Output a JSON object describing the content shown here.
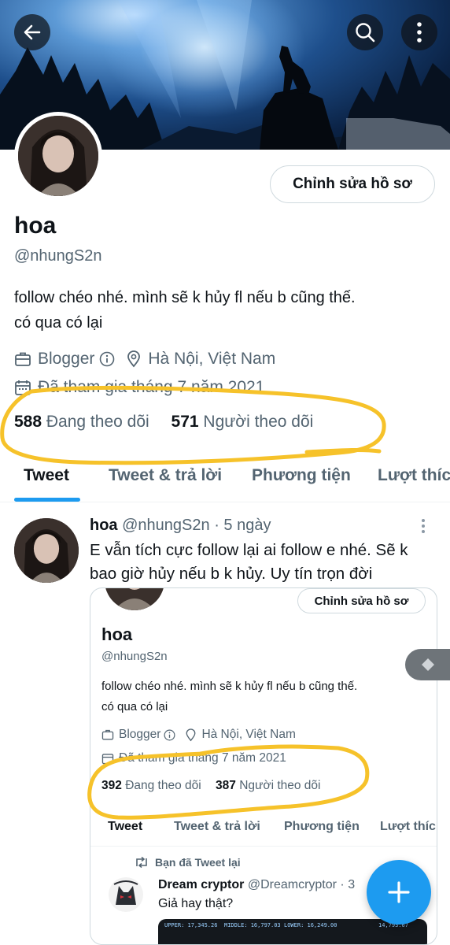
{
  "header": {
    "back_icon": "arrow-left-icon",
    "search_icon": "search-icon",
    "more_icon": "more-vertical-icon"
  },
  "profile": {
    "edit_button": "Chỉnh sửa hồ sơ",
    "name": "hoa",
    "handle": "@nhungS2n",
    "bio_line1": "follow chéo nhé. mình sẽ k hủy fl nếu b cũng thế.",
    "bio_line2": "có qua có lại",
    "category": "Blogger",
    "location": "Hà Nội, Việt Nam",
    "joined": "Đã tham gia tháng 7 năm 2021",
    "following_count": "588",
    "following_label": "Đang theo dõi",
    "followers_count": "571",
    "followers_label": "Người theo dõi"
  },
  "tabs": [
    "Tweet",
    "Tweet & trả lời",
    "Phương tiện",
    "Lượt thích"
  ],
  "tweet": {
    "name": "hoa",
    "handle": "@nhungS2n",
    "time": "· 5 ngày",
    "text": "E vẫn tích cực follow lại ai follow e nhé. Sẽ k bao giờ hủy nếu b k hủy. Uy tín trọn đời"
  },
  "embed": {
    "edit_button": "Chỉnh sửa hồ sơ",
    "name": "hoa",
    "handle": "@nhungS2n",
    "bio_line1": "follow chéo nhé. mình sẽ k hủy fl nếu b cũng thế.",
    "bio_line2": "có qua có lại",
    "category": "Blogger",
    "location": "Hà Nội, Việt Nam",
    "joined": "Đã tham gia tháng 7 năm 2021",
    "following_count": "392",
    "following_label": "Đang theo dõi",
    "followers_count": "387",
    "followers_label": "Người theo dõi",
    "tabs": [
      "Tweet",
      "Tweet & trả lời",
      "Phương tiện",
      "Lượt thíc"
    ],
    "retweet_label": "Bạn đã Tweet lại",
    "rt_name": "Dream cryptor",
    "rt_handle": "@Dreamcryptor · 3",
    "rt_text": "Giả hay thật?",
    "media_texts": [
      "UPPER: 17,345.26",
      "MIDDLE: 16,797.03",
      "LOWER: 16,249.00",
      "14,793.67"
    ]
  },
  "colors": {
    "accent": "#1d9bf0",
    "highlight": "#f6c22a",
    "secondary_text": "#536471"
  }
}
